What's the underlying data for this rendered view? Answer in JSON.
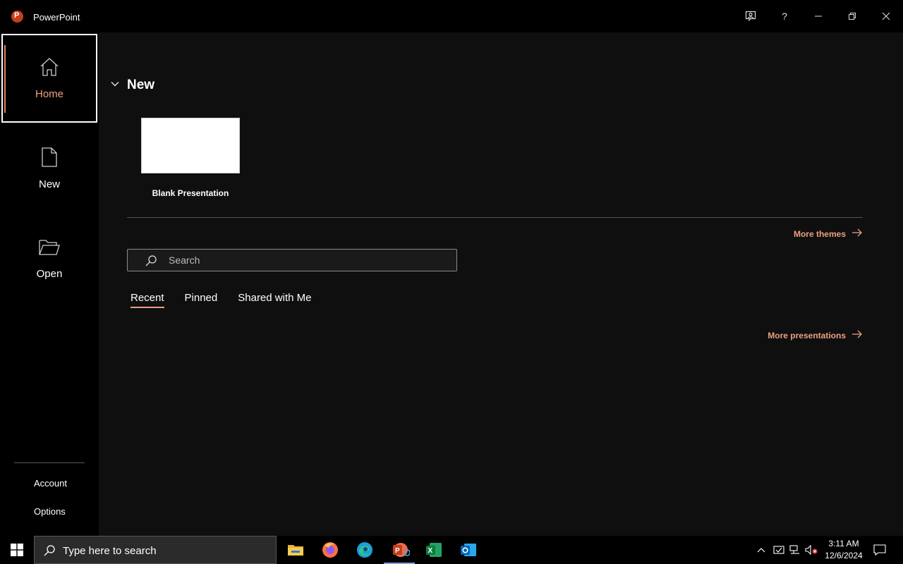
{
  "window": {
    "app_title": "PowerPoint",
    "logo_letter": "P",
    "accent_color": "#c43e1c",
    "controls": [
      "coauthor-icon",
      "help-icon",
      "minimize-icon",
      "restore-icon",
      "close-icon"
    ],
    "help_label": "?"
  },
  "sidebar": {
    "items": [
      {
        "label": "Home",
        "icon": "home-icon",
        "active": true
      },
      {
        "label": "New",
        "icon": "new-document-icon",
        "active": false
      },
      {
        "label": "Open",
        "icon": "folder-open-icon",
        "active": false
      }
    ],
    "bottom_links": [
      "Account",
      "Options"
    ]
  },
  "main": {
    "new_section": {
      "heading": "New",
      "templates": [
        {
          "caption": "Blank Presentation"
        }
      ]
    },
    "more_themes": "More themes",
    "search": {
      "placeholder": "Search",
      "value": ""
    },
    "tabs": [
      {
        "label": "Recent",
        "active": true
      },
      {
        "label": "Pinned",
        "active": false
      },
      {
        "label": "Shared with Me",
        "active": false
      }
    ],
    "more_presentations": "More presentations"
  },
  "taskbar": {
    "search_placeholder": "Type here to search",
    "apps": [
      "file-explorer-icon",
      "firefox-icon",
      "edge-icon",
      "powerpoint-icon",
      "excel-icon",
      "outlook-icon"
    ],
    "active_app": "powerpoint-icon",
    "time": "3:11 AM",
    "date": "12/6/2024"
  }
}
